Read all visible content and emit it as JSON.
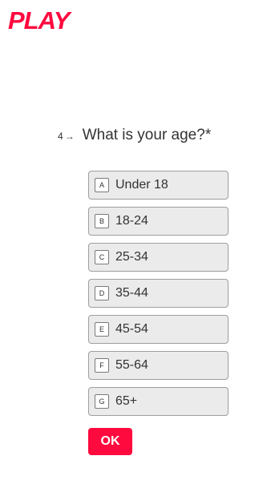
{
  "brand": {
    "logo_text": "PLAY",
    "logo_color": "#ff0a3f"
  },
  "question": {
    "number": "4",
    "arrow": "→",
    "text": "What is your age?*"
  },
  "choices": [
    {
      "key": "A",
      "label": "Under 18"
    },
    {
      "key": "B",
      "label": "18-24"
    },
    {
      "key": "C",
      "label": "25-34"
    },
    {
      "key": "D",
      "label": "35-44"
    },
    {
      "key": "E",
      "label": "45-54"
    },
    {
      "key": "F",
      "label": "55-64"
    },
    {
      "key": "G",
      "label": "65+"
    }
  ],
  "ok_button": {
    "label": "OK",
    "color": "#ff0a3f"
  }
}
